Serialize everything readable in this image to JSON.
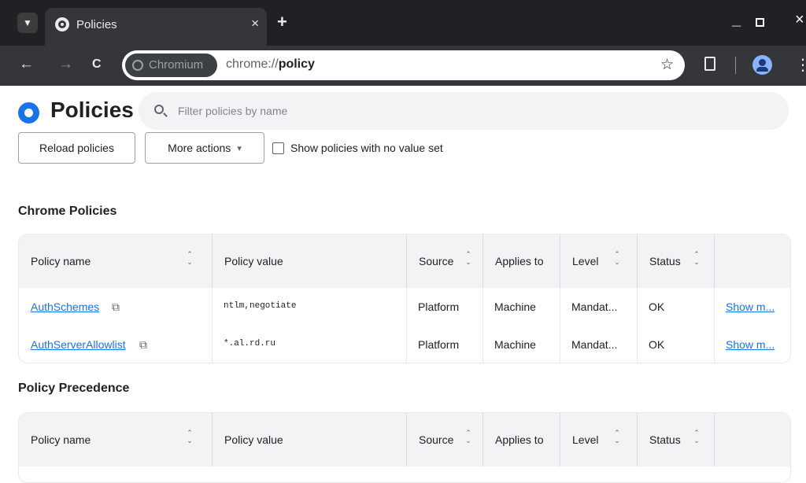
{
  "browser": {
    "tab": {
      "title": "Policies",
      "close": "×"
    },
    "new_tab": "+",
    "window": {
      "minimize": "_",
      "close": "×"
    },
    "nav": {
      "back": "←",
      "forward": "→",
      "reload": "C"
    },
    "omnibox": {
      "chip": "Chromium",
      "url_prefix": "chrome://",
      "url_path": "policy",
      "star": "☆"
    },
    "menu": "⋮"
  },
  "page": {
    "title": "Policies",
    "search_placeholder": "Filter policies by name",
    "buttons": {
      "reload": "Reload policies",
      "more_actions": "More actions",
      "more_actions_arrow": "▾"
    },
    "checkbox_label": "Show policies with no value set",
    "sections": [
      {
        "title": "Chrome Policies"
      },
      {
        "title": "Policy Precedence"
      }
    ],
    "columns": [
      "Policy name",
      "Policy value",
      "Source",
      "Applies to",
      "Level",
      "Status"
    ],
    "rows": [
      {
        "name": "AuthSchemes",
        "value": "ntlm,negotiate",
        "source": "Platform",
        "applies_to": "Machine",
        "level": "Mandat...",
        "status": "OK",
        "more": "Show m..."
      },
      {
        "name": "AuthServerAllowlist",
        "value": "*.al.rd.ru",
        "source": "Platform",
        "applies_to": "Machine",
        "level": "Mandat...",
        "status": "OK",
        "more": "Show m..."
      }
    ]
  }
}
